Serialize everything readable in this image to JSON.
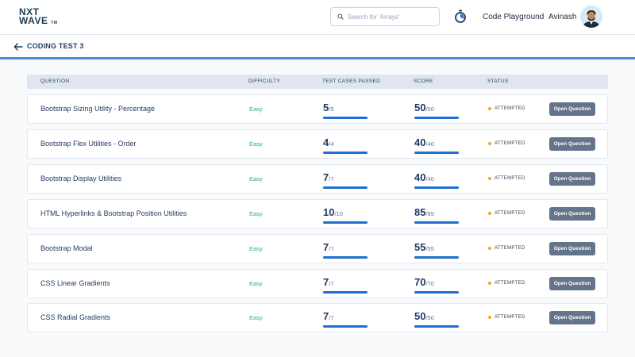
{
  "navbar": {
    "logo_line1": "NXT",
    "logo_line2": "WAVE",
    "logo_tm": "TM",
    "search_placeholder": "Search for 'Arrays'",
    "playground_label": "Code Playground",
    "user_name": "Avinash"
  },
  "subheader": {
    "title": "CODING TEST 3"
  },
  "table": {
    "headers": {
      "question": "QUESTION",
      "difficulty": "DIFFICULTY",
      "tests": "TEST CASES PASSED",
      "score": "SCORE",
      "status": "STATUS"
    },
    "rows": [
      {
        "question": "Bootstrap Sizing Utility - Percentage",
        "difficulty": "Easy",
        "passed": "5",
        "total": "/5",
        "score": "50",
        "max": "/50",
        "status": "ATTEMPTED",
        "action": "Open Question"
      },
      {
        "question": "Bootstrap Flex Utilities - Order",
        "difficulty": "Easy",
        "passed": "4",
        "total": "/4",
        "score": "40",
        "max": "/40",
        "status": "ATTEMPTED",
        "action": "Open Question"
      },
      {
        "question": "Bootstrap Display Utilities",
        "difficulty": "Easy",
        "passed": "7",
        "total": "/7",
        "score": "40",
        "max": "/40",
        "status": "ATTEMPTED",
        "action": "Open Question"
      },
      {
        "question": "HTML Hyperlinks & Bootstrap Position Utilities",
        "difficulty": "Easy",
        "passed": "10",
        "total": "/10",
        "score": "85",
        "max": "/85",
        "status": "ATTEMPTED",
        "action": "Open Question"
      },
      {
        "question": "Bootstrap Modal",
        "difficulty": "Easy",
        "passed": "7",
        "total": "/7",
        "score": "55",
        "max": "/55",
        "status": "ATTEMPTED",
        "action": "Open Question"
      },
      {
        "question": "CSS Linear Gradients",
        "difficulty": "Easy",
        "passed": "7",
        "total": "/7",
        "score": "70",
        "max": "/70",
        "status": "ATTEMPTED",
        "action": "Open Question"
      },
      {
        "question": "CSS Radial Gradients",
        "difficulty": "Easy",
        "passed": "7",
        "total": "/7",
        "score": "50",
        "max": "/50",
        "status": "ATTEMPTED",
        "action": "Open Question"
      }
    ]
  },
  "colors": {
    "brand": "#183b56",
    "accent": "#1e6fd0",
    "easy": "#22b46a",
    "attempted": "#f5a623"
  }
}
